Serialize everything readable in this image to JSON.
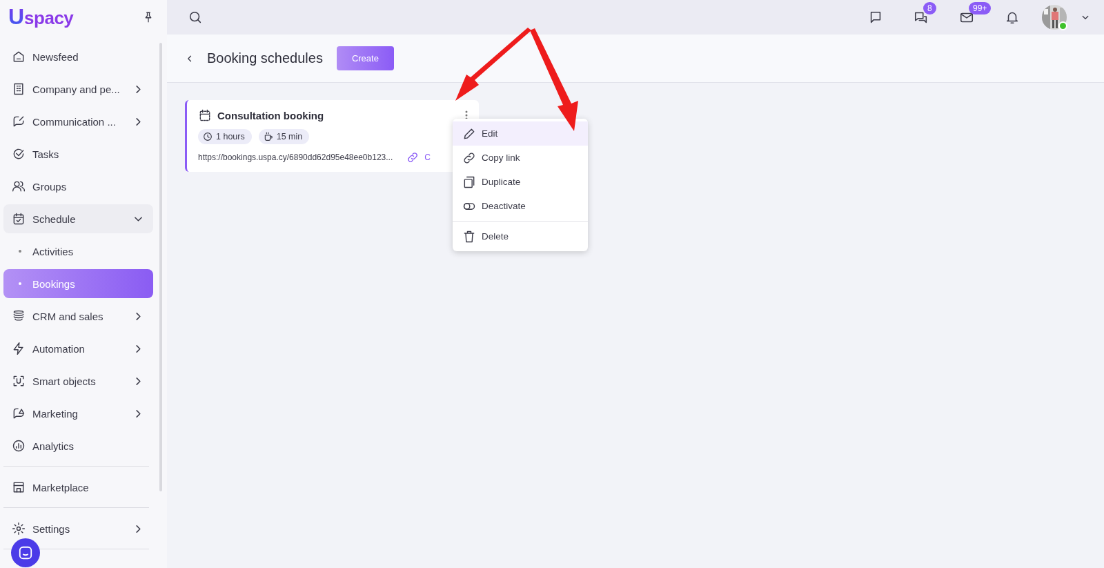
{
  "logo": {
    "mark": "U",
    "name": "spacy"
  },
  "nav": [
    {
      "label": "Newsfeed",
      "kind": "link",
      "selected": false
    },
    {
      "label": "Company and pe...",
      "kind": "group",
      "selected": false,
      "expanded": false
    },
    {
      "label": "Communication ...",
      "kind": "group",
      "selected": false,
      "expanded": false
    },
    {
      "label": "Tasks",
      "kind": "link",
      "selected": false
    },
    {
      "label": "Groups",
      "kind": "link",
      "selected": false
    },
    {
      "label": "Schedule",
      "kind": "group",
      "selected": false,
      "expanded": true
    },
    {
      "label": "Activities",
      "kind": "sub",
      "selected": false
    },
    {
      "label": "Bookings",
      "kind": "sub",
      "selected": true
    },
    {
      "label": "CRM and sales",
      "kind": "group",
      "selected": false,
      "expanded": false
    },
    {
      "label": "Automation",
      "kind": "group",
      "selected": false,
      "expanded": false
    },
    {
      "label": "Smart objects",
      "kind": "group",
      "selected": false,
      "expanded": false
    },
    {
      "label": "Marketing",
      "kind": "group",
      "selected": false,
      "expanded": false
    },
    {
      "label": "Analytics",
      "kind": "link",
      "selected": false
    }
  ],
  "bottom_nav": [
    {
      "label": "Marketplace",
      "kind": "link",
      "selected": false
    },
    {
      "label": "Settings",
      "kind": "group",
      "selected": false,
      "expanded": false
    }
  ],
  "topbar": {
    "chat_badge": "8",
    "mail_badge": "99+",
    "online": true
  },
  "page": {
    "title": "Booking schedules",
    "create": "Create"
  },
  "card": {
    "title": "Consultation booking",
    "chips": [
      "1 hours",
      "15 min"
    ],
    "url": "https://bookings.uspa.cy/6890dd62d95e48ee0b123...",
    "copy_text": "C"
  },
  "menu": [
    {
      "label": "Edit",
      "selected": true,
      "divider_before": false
    },
    {
      "label": "Copy link",
      "selected": false,
      "divider_before": false
    },
    {
      "label": "Duplicate",
      "selected": false,
      "divider_before": false
    },
    {
      "label": "Deactivate",
      "selected": false,
      "divider_before": false
    },
    {
      "label": "Delete",
      "selected": false,
      "divider_before": true
    }
  ]
}
